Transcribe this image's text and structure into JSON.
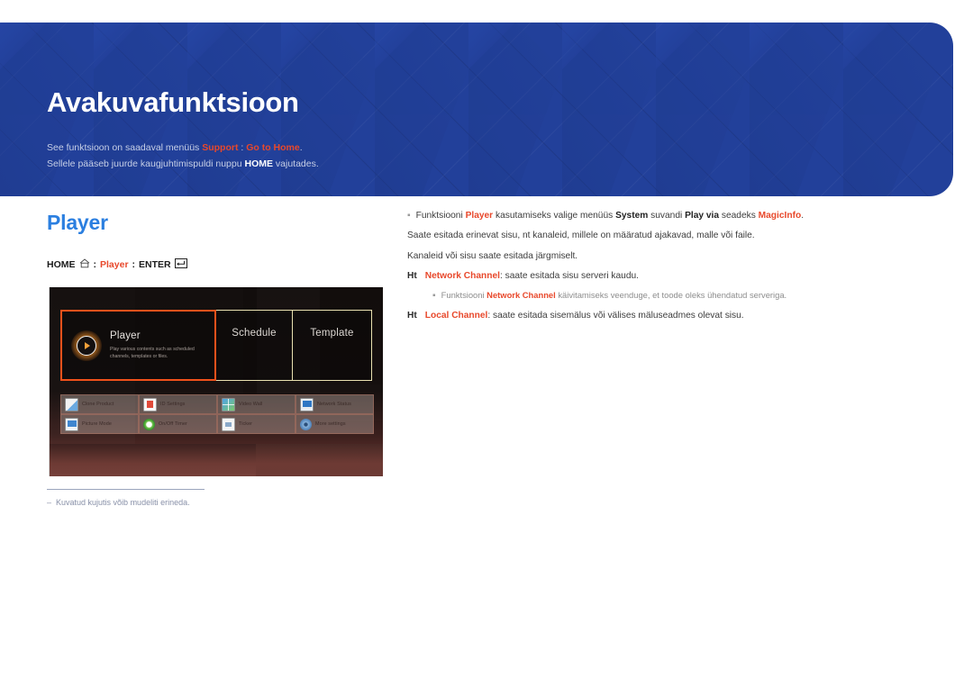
{
  "banner": {
    "title": "Avakuvafunktsioon",
    "sub_line1_a": "See funktsioon on saadaval menüüs ",
    "sub_line1_support": "Support",
    "sub_line1_sep": " : ",
    "sub_line1_goto": "Go to Home",
    "sub_line1_end": ".",
    "sub_line2_a": "Sellele pääseb juurde kaugjuhtimispuldi nuppu ",
    "sub_line2_home": "HOME",
    "sub_line2_b": " vajutades."
  },
  "section": {
    "title": "Player"
  },
  "breadcrumb": {
    "home_label": "HOME",
    "home_icon": "home-icon",
    "sep1": ":",
    "player_label": "Player",
    "sep2": ":",
    "enter_label": "ENTER",
    "enter_icon": "enter-key-icon"
  },
  "mockup": {
    "tiles": [
      {
        "name": "player",
        "title": "Player",
        "desc": "Play various contents such as scheduled channels, templates or files.",
        "selected": true,
        "icon": "play-circle-icon"
      },
      {
        "name": "schedule",
        "title": "Schedule",
        "selected": false
      },
      {
        "name": "template",
        "title": "Template",
        "selected": false
      }
    ],
    "grid": [
      {
        "label": "Clone Product",
        "icon": "clone-product-icon"
      },
      {
        "label": "ID Settings",
        "icon": "id-settings-icon"
      },
      {
        "label": "Video Wall",
        "icon": "video-wall-icon"
      },
      {
        "label": "Network Status",
        "icon": "network-status-icon"
      },
      {
        "label": "Picture Mode",
        "icon": "picture-mode-icon"
      },
      {
        "label": "On/Off Timer",
        "icon": "on-off-timer-icon"
      },
      {
        "label": "Ticker",
        "icon": "ticker-icon"
      },
      {
        "label": "More settings",
        "icon": "more-settings-icon"
      }
    ],
    "caption_dash": "‒",
    "caption": "Kuvatud kujutis võib mudeliti erineda."
  },
  "content": {
    "bullet_square": "▪",
    "bullet_ht": "Ht",
    "line1": {
      "bullet": "▪",
      "a": "Funktsiooni ",
      "player": "Player",
      "b": " kasutamiseks valige menüüs ",
      "system": "System",
      "c": " suvandi ",
      "playvia": "Play via",
      "d": " seadeks ",
      "magicinfo": "MagicInfo",
      "e": "."
    },
    "line2": "Saate esitada erinevat sisu, nt kanaleid, millele on määratud ajakavad, malle või faile.",
    "line3": "Kanaleid või sisu saate esitada järgmiselt.",
    "line4": {
      "bullet": "Ht",
      "name": "Network Channel",
      "rest": ": saate esitada sisu serveri kaudu."
    },
    "line5": {
      "bullet": "▪",
      "a": "Funktsiooni ",
      "name": "Network Channel",
      "b": " käivitamiseks veenduge, et toode oleks ühendatud serveriga."
    },
    "line6": {
      "bullet": "Ht",
      "name": "Local Channel",
      "rest": ": saate esitada sisemälus või välises mäluseadmes olevat sisu."
    }
  },
  "colors": {
    "banner_blue": "#22409a",
    "accent_red": "#e8482b",
    "section_blue": "#2b7fe0",
    "tile_highlight": "#f0511b",
    "tile_border": "#e9e0b0"
  }
}
